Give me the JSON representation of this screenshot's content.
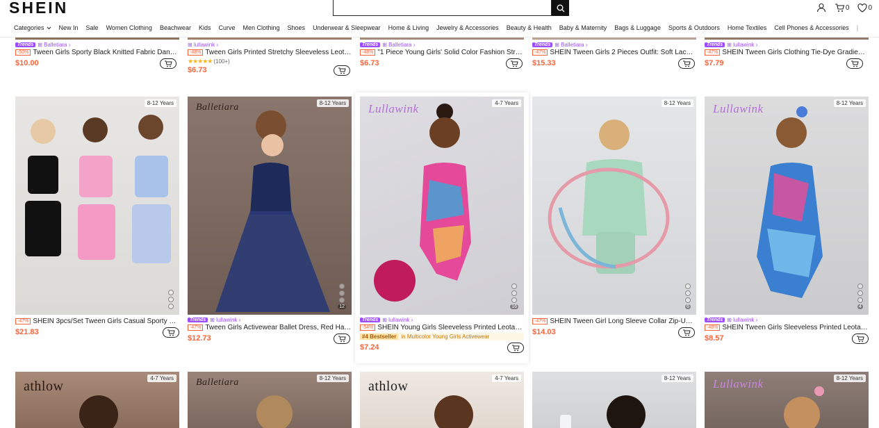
{
  "header": {
    "logo": "SHEIN",
    "search_placeholder": "",
    "cart_count": "0",
    "wishlist_count": "0"
  },
  "nav": {
    "items": [
      "Categories",
      "New In",
      "Sale",
      "Women Clothing",
      "Beachwear",
      "Kids",
      "Curve",
      "Men Clothing",
      "Shoes",
      "Underwear & Sleepwear",
      "Home & Living",
      "Jewelry & Accessories",
      "Beauty & Health",
      "Baby & Maternity",
      "Bags & Luggage",
      "Sports & Outdoors",
      "Home Textiles",
      "Cell Phones & Accessories"
    ]
  },
  "row1": [
    {
      "trends": "Trends",
      "store": "Balletiara",
      "discount": "-50%",
      "title": "Tween Girls Sporty Black Knitted Fabric Dance...",
      "price": "$10.00"
    },
    {
      "trends": "",
      "store": "lullawink",
      "discount": "-48%",
      "title": "Tween Girls Printed Stretchy Sleeveless Leotard...",
      "price": "$6.73",
      "rating_count": "(100+)"
    },
    {
      "trends": "Trends",
      "store": "Balletiara",
      "discount": "-48%",
      "title": "\"1 Piece Young Girls' Solid Color Fashion Stretc...",
      "price": "$6.73"
    },
    {
      "trends": "Trends",
      "store": "Balletiara",
      "discount": "-47%",
      "title": "SHEIN Tween Girls 2 Pieces Outfit: Soft Lace Ba...",
      "price": "$15.33"
    },
    {
      "trends": "Trends",
      "store": "lullawink",
      "discount": "-47%",
      "title": "SHEIN Tween Girls Clothing Tie-Dye Gradient R...",
      "price": "$7.79"
    }
  ],
  "row2": [
    {
      "age": "8-12 Years",
      "trends": "",
      "store": "",
      "discount": "-47%",
      "title": "SHEIN 3pcs/Set Tween Girls Casual Sporty Soli...",
      "price": "$21.83",
      "images": "",
      "brand_mark": ""
    },
    {
      "age": "8-12 Years",
      "trends": "Trends",
      "store": "lullawink",
      "discount": "-47%",
      "title": "Tween Girls Activewear Ballet Dress, Red Halter...",
      "price": "$12.73",
      "images": "12",
      "brand_mark": "Balletiara"
    },
    {
      "age": "4-7 Years",
      "trends": "Trends",
      "store": "lullawink",
      "discount": "-54%",
      "title": "SHEIN Young Girls Sleeveless Printed Leotards,...",
      "price": "$7.24",
      "images": "16",
      "brand_mark": "Lullawink",
      "bestseller": "#4 Bestseller",
      "bestseller_text": "in Multicolor Young Girls Activewear"
    },
    {
      "age": "8-12 Years",
      "trends": "",
      "store": "",
      "discount": "-47%",
      "title": "SHEIN Tween Girl Long Sleeve Collar Zip-Up T-...",
      "price": "$14.03",
      "images": "6",
      "brand_mark": ""
    },
    {
      "age": "8-12 Years",
      "trends": "Trends",
      "store": "lullawink",
      "discount": "-48%",
      "title": "SHEIN Tween Girls Sleeveless Printed Leotards,...",
      "price": "$8.57",
      "images": "4",
      "brand_mark": "Lullawink"
    }
  ],
  "row3": [
    {
      "age": "4-7 Years",
      "brand_mark": "athlow"
    },
    {
      "age": "8-12 Years",
      "brand_mark": "Balletiara"
    },
    {
      "age": "4-7 Years",
      "brand_mark": "athlow"
    },
    {
      "age": "8-12 Years",
      "brand_mark": ""
    },
    {
      "age": "8-12 Years",
      "brand_mark": "Lullawink"
    }
  ],
  "colors": {
    "price": "#fa6338",
    "trends": "#9b4dff",
    "accent": "#222222"
  }
}
